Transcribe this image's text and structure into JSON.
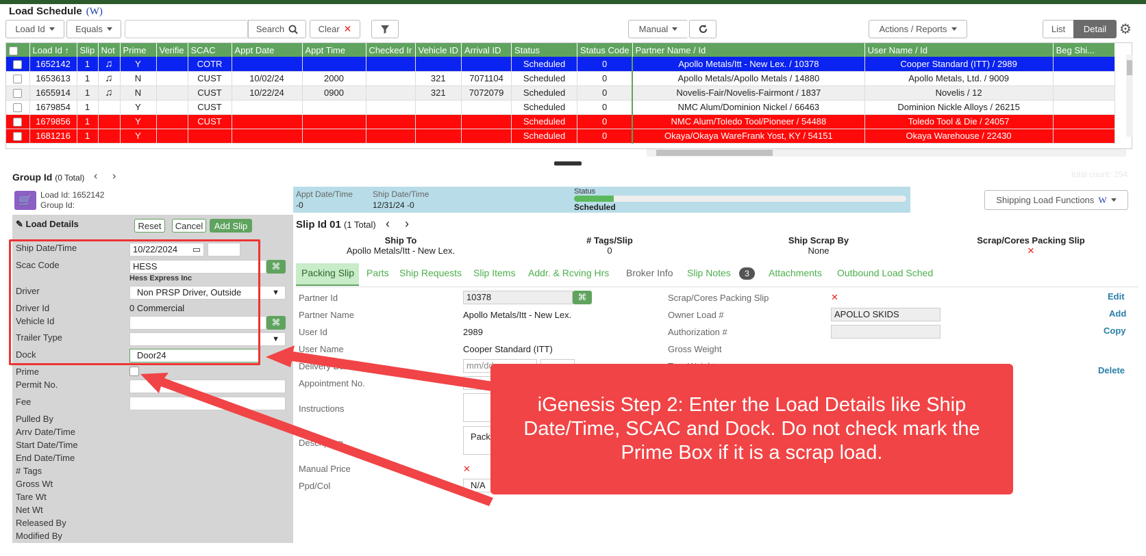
{
  "title": "Load Schedule",
  "title_w": "W",
  "toolbar": {
    "field": "Load Id",
    "op": "Equals",
    "search_value": "",
    "search": "Search",
    "clear": "Clear",
    "manual": "Manual",
    "actions": "Actions / Reports",
    "list": "List",
    "detail": "Detail"
  },
  "grid": {
    "headers": [
      "Load Id ↑",
      "Slip",
      "Not",
      "Prime",
      "Verifie",
      "SCAC",
      "Appt Date",
      "Appt Time",
      "Checked Ir",
      "Vehicle ID",
      "Arrival ID",
      "Status",
      "Status Code",
      "Partner Name / Id",
      "User Name / Id",
      "Beg Shi..."
    ],
    "rows": [
      {
        "style": "sel",
        "load_id": "1652142",
        "slip": "1",
        "note": true,
        "prime": "Y",
        "scac": "COTR",
        "appt_date": "",
        "appt_time": "",
        "vehicle": "",
        "arrival": "",
        "status": "Scheduled",
        "code": "0",
        "partner": "Apollo Metals/Itt - New Lex. / 10378",
        "user": "Cooper Standard (ITT) / 2989"
      },
      {
        "style": "",
        "load_id": "1653613",
        "slip": "1",
        "note": true,
        "prime": "N",
        "scac": "CUST",
        "appt_date": "10/02/24",
        "appt_time": "2000",
        "vehicle": "321",
        "arrival": "7071104",
        "status": "Scheduled",
        "code": "0",
        "partner": "Apollo Metals/Apollo Metals / 14880",
        "user": "Apollo Metals, Ltd. / 9009"
      },
      {
        "style": "grey",
        "load_id": "1655914",
        "slip": "1",
        "note": true,
        "prime": "N",
        "scac": "CUST",
        "appt_date": "10/22/24",
        "appt_time": "0900",
        "vehicle": "321",
        "arrival": "7072079",
        "status": "Scheduled",
        "code": "0",
        "partner": "Novelis-Fair/Novelis-Fairmont / 1837",
        "user": "Novelis / 12"
      },
      {
        "style": "",
        "load_id": "1679854",
        "slip": "1",
        "note": false,
        "prime": "Y",
        "scac": "CUST",
        "appt_date": "",
        "appt_time": "",
        "vehicle": "",
        "arrival": "",
        "status": "Scheduled",
        "code": "0",
        "partner": "NMC Alum/Dominion Nickel / 66463",
        "user": "Dominion Nickle Alloys / 26215"
      },
      {
        "style": "red",
        "load_id": "1679856",
        "slip": "1",
        "note": false,
        "prime": "Y",
        "scac": "CUST",
        "appt_date": "",
        "appt_time": "",
        "vehicle": "",
        "arrival": "",
        "status": "Scheduled",
        "code": "0",
        "partner": "NMC Alum/Toledo Tool/Pioneer / 54488",
        "user": "Toledo Tool & Die / 24057"
      },
      {
        "style": "red",
        "load_id": "1681216",
        "slip": "1",
        "note": false,
        "prime": "Y",
        "scac": "",
        "appt_date": "",
        "appt_time": "",
        "vehicle": "",
        "arrival": "",
        "status": "Scheduled",
        "code": "0",
        "partner": "Okaya/Okaya WareFrank Yost, KY / 54151",
        "user": "Okaya Warehouse / 22430"
      }
    ]
  },
  "group": {
    "label": "Group Id",
    "total": "(0 Total)",
    "total_count": "total count: 294"
  },
  "load": {
    "id_label": "Load Id: 1652142",
    "group_label": "Group Id:"
  },
  "status_bar": {
    "appt_label": "Appt Date/Time",
    "appt_val": "-0",
    "ship_label": "Ship Date/Time",
    "ship_val": "12/31/24 -0",
    "status_label": "Status",
    "status_val": "Scheduled",
    "progress": 0.12
  },
  "shipping_fn": "Shipping Load Functions",
  "load_details": {
    "title": "Load Details",
    "reset": "Reset",
    "cancel": "Cancel",
    "add_slip": "Add Slip",
    "ship_date_label": "Ship Date/Time",
    "ship_date": "10/22/2024",
    "scac_label": "Scac Code",
    "scac": "HESS",
    "scac_name": "Hess Express Inc",
    "driver_label": "Driver",
    "driver": "Non PRSP Driver, Outside",
    "driver_id_label": "Driver Id",
    "driver_id": "0 Commercial",
    "vehicle_label": "Vehicle Id",
    "trailer_label": "Trailer Type",
    "dock_label": "Dock",
    "dock": "Door24",
    "prime_label": "Prime",
    "permit_label": "Permit No.",
    "fee_label": "Fee",
    "extra": [
      "Pulled By",
      "Arrv Date/Time",
      "Start Date/Time",
      "End Date/Time",
      "# Tags",
      "Gross Wt",
      "Tare Wt",
      "Net Wt",
      "Released By",
      "Modified By"
    ]
  },
  "slip": {
    "title": "Slip Id 01",
    "total": "(1 Total)",
    "ship_to_label": "Ship To",
    "ship_to": "Apollo Metals/Itt - New Lex.",
    "tags_label": "# Tags/Slip",
    "tags": "0",
    "scrap_by_label": "Ship Scrap By",
    "scrap_by": "None",
    "cores_label": "Scrap/Cores Packing Slip",
    "cores": "✕"
  },
  "tabs": [
    "Packing Slip",
    "Parts",
    "Ship Requests",
    "Slip Items",
    "Addr. & Rcving Hrs",
    "Broker Info",
    "Slip Notes",
    "Attachments",
    "Outbound Load Sched"
  ],
  "notes_count": "3",
  "details": {
    "partner_id_label": "Partner Id",
    "partner_id": "10378",
    "partner_name_label": "Partner Name",
    "partner_name": "Apollo Metals/Itt - New Lex.",
    "user_id_label": "User Id",
    "user_id": "2989",
    "user_name_label": "User Name",
    "user_name": "Cooper Standard (ITT)",
    "delivery_label": "Delivery Date/Time",
    "delivery_ph": "mm/dd",
    "appt_no_label": "Appointment No.",
    "instructions_label": "Instructions",
    "description_label": "Description",
    "description_val": "Packa",
    "manual_price_label": "Manual Price",
    "manual_price": "✕",
    "ppd_label": "Ppd/Col",
    "ppd": "N/A",
    "scrap_cores_label": "Scrap/Cores Packing Slip",
    "scrap_cores": "✕",
    "owner_load_label": "Owner Load #",
    "owner_load": "APOLLO SKIDS",
    "auth_label": "Authorization #",
    "gross_label": "Gross Weight",
    "tare_label": "Tare Weight",
    "edit": "Edit",
    "add": "Add",
    "copy": "Copy",
    "delete": "Delete"
  },
  "callout": "iGenesis Step 2: Enter the Load Details like Ship Date/Time, SCAC and Dock. Do not check mark the Prime Box if it is a scrap load."
}
